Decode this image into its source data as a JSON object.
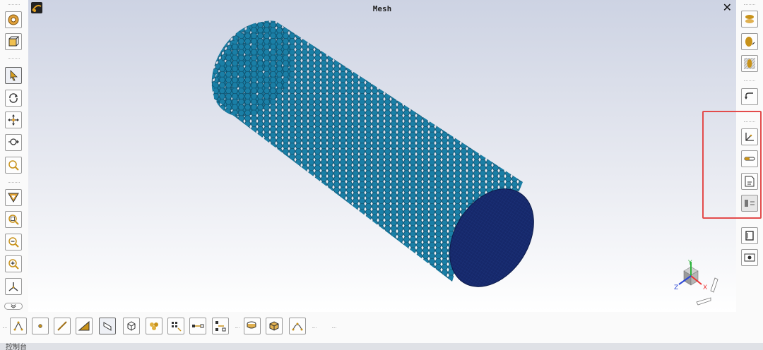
{
  "window": {
    "title": "Mesh",
    "close_label": "✕"
  },
  "statusbar": {
    "label": "控制台"
  },
  "colors": {
    "mesh_face": "#1a7fa6",
    "mesh_edge": "#0d4f6c",
    "mesh_cap": "#152a6c",
    "highlight": "#e34b4b",
    "icon_gold": "#c8921a"
  },
  "left_toolbar": [
    "geometry-icon",
    "cube-view-icon",
    "select-pointer-icon",
    "rotate-icon",
    "pan-icon",
    "zoom-icon",
    "zoom-window-icon",
    "filter-icon",
    "zoom-fit-icon",
    "zoom-out-icon",
    "zoom-in-icon",
    "axes-icon",
    "expand-chevron-icon"
  ],
  "right_toolbar": [
    "section-plane-icon",
    "clip-icon",
    "mesh-display-icon",
    "undo-view-icon",
    "axis-triad-icon",
    "ruler-icon",
    "notes-icon",
    "legend-icon",
    "frame-icon",
    "screenshot-icon"
  ],
  "bottom_toolbar": [
    "node-select-icon",
    "point-icon",
    "edge-icon",
    "face-icon",
    "surface-icon",
    "cell-icon",
    "multi-body-icon",
    "node-grid-icon",
    "edge-grid-icon",
    "face-grid-icon",
    "part-icon",
    "body-icon",
    "curve-icon"
  ],
  "triad": {
    "x_label": "X",
    "y_label": "Y",
    "z_label": "Z"
  }
}
